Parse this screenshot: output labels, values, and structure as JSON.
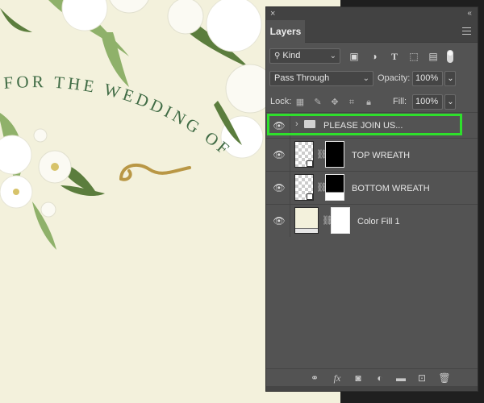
{
  "canvas": {
    "arc_text": "FOR THE WEDDING OF",
    "background": "#f3f1dc",
    "text_color": "#3f6b44",
    "swirl_color": "#b99745"
  },
  "panel": {
    "close_glyph": "×",
    "collapse_glyph": "‹‹",
    "tab_label": "Layers",
    "menu_icon": "panel-menu-icon",
    "filter": {
      "kind_label": "Kind",
      "search_icon": "search-icon",
      "icons": [
        "image-filter-icon",
        "adjustment-filter-icon",
        "type-filter-icon",
        "shape-filter-icon",
        "smart-object-filter-icon"
      ]
    },
    "blend_mode": "Pass Through",
    "opacity_label": "Opacity:",
    "opacity_value": "100%",
    "lock_label": "Lock:",
    "fill_label": "Fill:",
    "fill_value": "100%",
    "layers": [
      {
        "name": "PLEASE JOIN US...",
        "type": "group",
        "selected": true
      },
      {
        "name": "TOP WREATH",
        "type": "smart-object-with-mask"
      },
      {
        "name": "BOTTOM WREATH",
        "type": "smart-object-with-mask"
      },
      {
        "name": "Color Fill 1",
        "type": "fill",
        "fill_color": "#f3f1dc"
      }
    ],
    "bottom_icons": [
      "link-layers-icon",
      "fx-icon",
      "add-mask-icon",
      "adjustment-layer-icon",
      "new-group-icon",
      "new-layer-icon",
      "delete-icon"
    ],
    "highlight_color": "#2ee02b"
  }
}
